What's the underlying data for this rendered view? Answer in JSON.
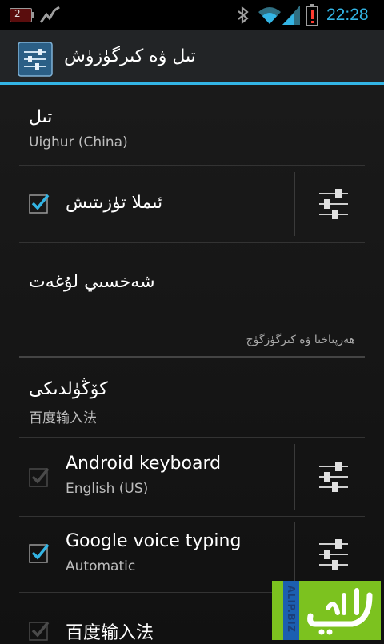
{
  "status_bar": {
    "notification_count": "2",
    "time": "22:28"
  },
  "action_bar": {
    "title": "تىل ۋە كىرگۈزۈش"
  },
  "items": {
    "language": {
      "title": "تىل",
      "summary": "Uighur (China)"
    },
    "spell_check": {
      "title": "ئىملا تۈزىتىش",
      "checked": true
    },
    "personal_dictionary": {
      "title": "شەخسىي لۇغەت"
    },
    "section_header": "ھەرپتاختا ۋە كىرگۈزگۈچ",
    "default": {
      "title": "كۆڭۈلدىكى",
      "summary": "百度输入法"
    },
    "android_keyboard": {
      "title": "Android keyboard",
      "summary": "English (US)",
      "checked": true,
      "disabled": true
    },
    "google_voice": {
      "title": "Google voice typing",
      "summary": "Automatic",
      "checked": true
    },
    "baidu": {
      "title": "百度输入法",
      "checked": true,
      "disabled": true
    }
  },
  "watermark": {
    "text": "ALIP.BIZ",
    "colors": {
      "green": "#7cc21f",
      "blue": "#1c5fb0"
    }
  },
  "colors": {
    "accent": "#33b5e5",
    "background": "#111111"
  }
}
